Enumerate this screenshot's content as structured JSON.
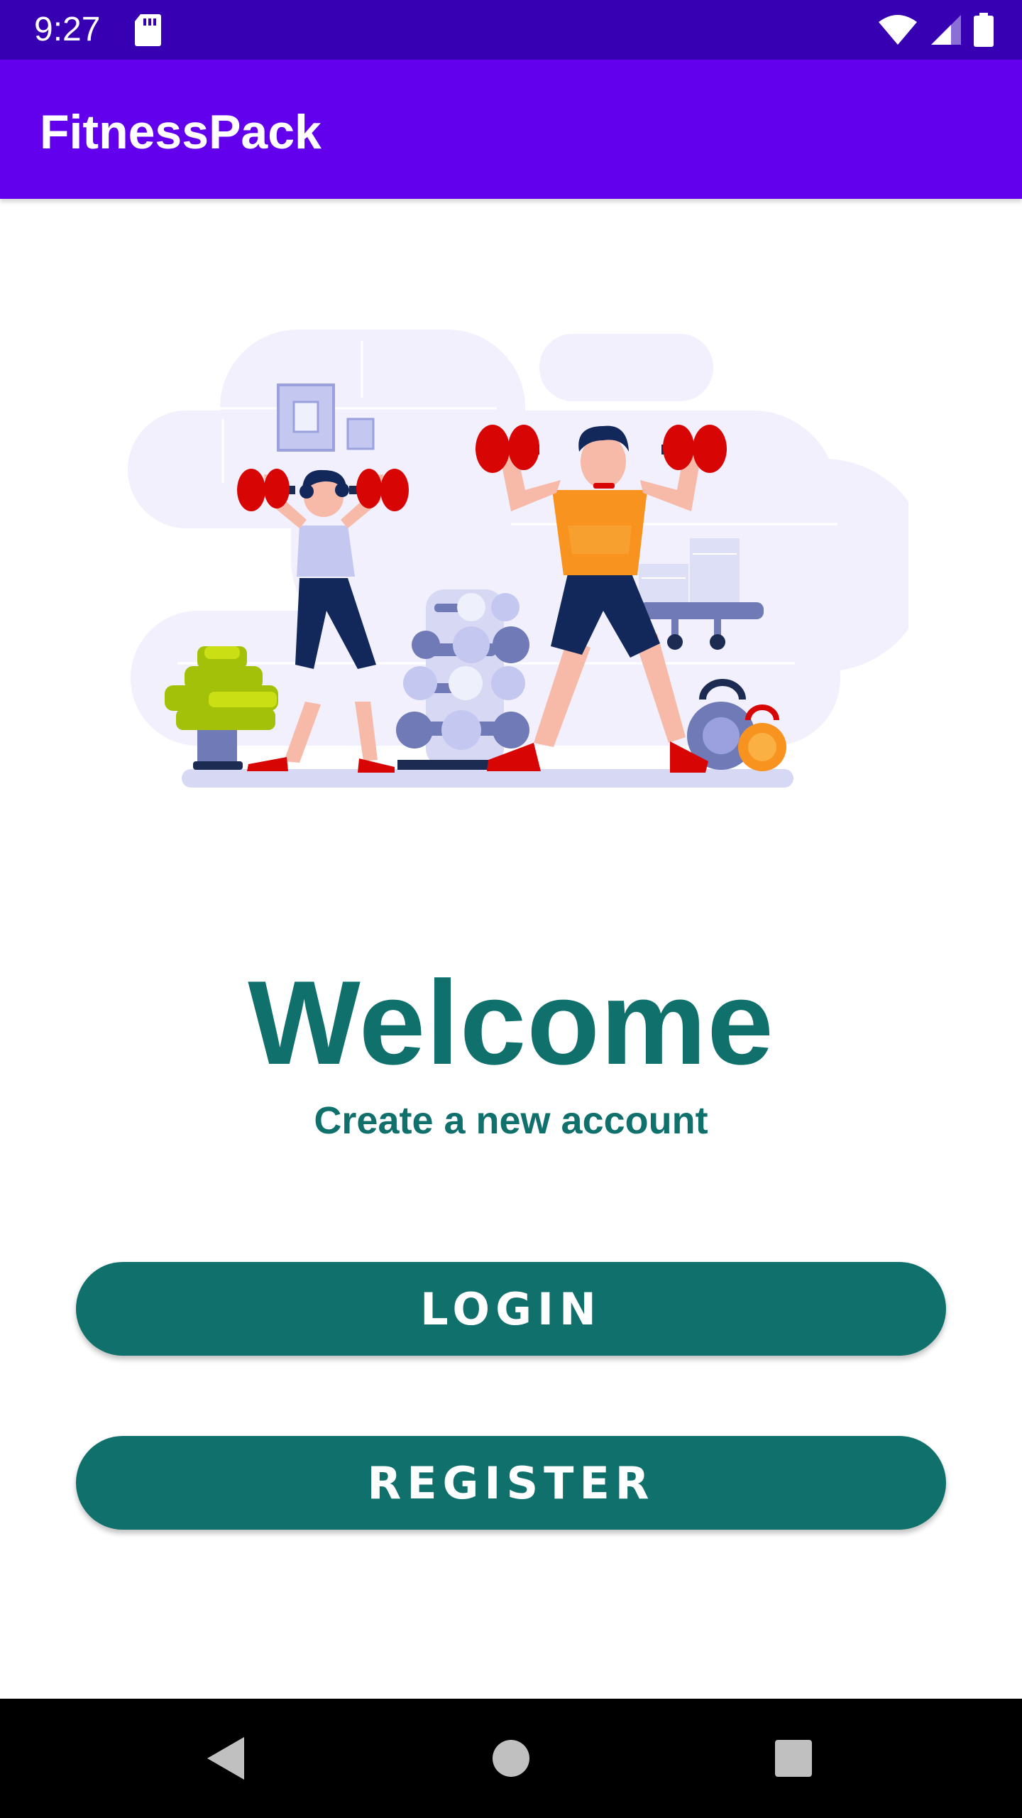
{
  "status_bar": {
    "time": "9:27",
    "icons": [
      "sd-card-icon",
      "wifi-icon",
      "signal-icon",
      "battery-icon"
    ],
    "color": "#3700b3"
  },
  "app_bar": {
    "title": "FitnessPack",
    "color": "#6200ee"
  },
  "illustration": {
    "description_icon": "fitness-illustration"
  },
  "welcome": {
    "title": "Welcome",
    "subtitle": "Create a new account",
    "color": "#0f706c"
  },
  "buttons": {
    "login_label": "LOGIN",
    "register_label": "REGISTER",
    "color": "#0f706c"
  },
  "nav_bar": {
    "icons": [
      "back-icon",
      "home-icon",
      "recents-icon"
    ]
  }
}
